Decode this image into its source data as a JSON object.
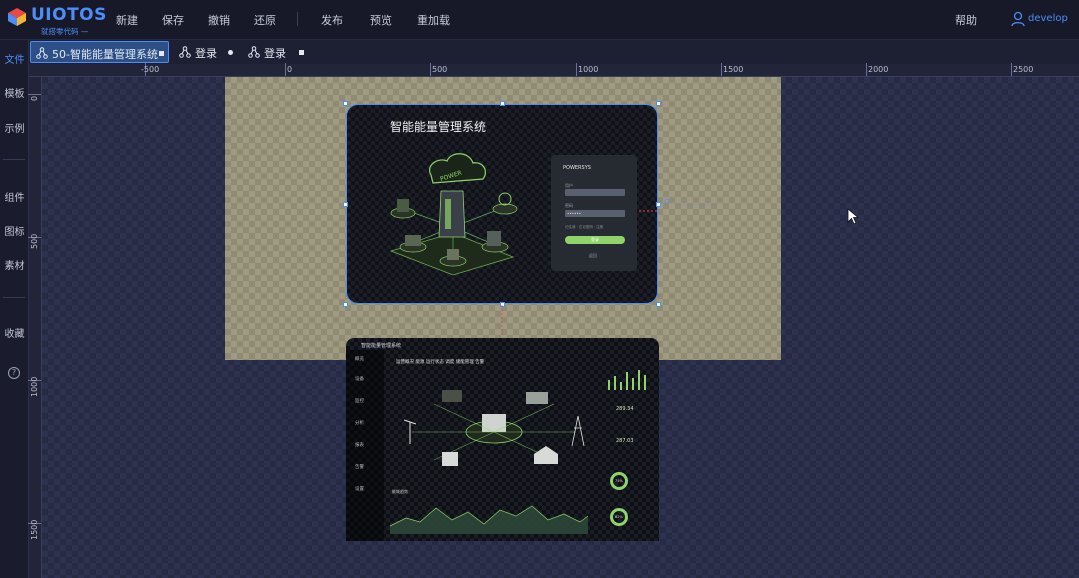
{
  "app": {
    "logo_text": "UIOTOS",
    "logo_sub": "就搭零代码 —"
  },
  "menu": {
    "items": [
      "新建",
      "保存",
      "撤销",
      "还原",
      "发布",
      "预览",
      "重加载"
    ],
    "help": "帮助",
    "user": "develop"
  },
  "sidebar": {
    "items": [
      "文件",
      "模板",
      "示例",
      "组件",
      "图标",
      "素材",
      "收藏"
    ],
    "active": "文件",
    "help_glyph": "?"
  },
  "tabs": [
    {
      "label": "50-智能能量管理系统",
      "active": true
    },
    {
      "label": "登录",
      "active": false
    },
    {
      "label": "登录",
      "active": false
    }
  ],
  "ruler": {
    "top_labels": [
      "-500",
      "0",
      "500",
      "1000",
      "1500",
      "2000",
      "2500"
    ],
    "left_labels": [
      "0",
      "500",
      "1000",
      "1500"
    ]
  },
  "login_preview": {
    "title": "智能能量管理系统",
    "brand": "POWERSYS",
    "user_label": "用户",
    "pass_label": "密码",
    "pass_value": "••••••",
    "hint": "记住我 · 忘记密码 · 注册",
    "login_button": "登录",
    "back": "返回"
  },
  "dashboard_preview": {
    "title": "智能能量管理系统",
    "side_items": [
      "概览",
      "设备",
      "监控",
      "分析",
      "报表",
      "告警",
      "设置"
    ],
    "tabs": "运营概况  能源  运行状态  调度  储能管理  告警",
    "stats": [
      "289.34",
      "287.03"
    ],
    "rings": [
      "75%",
      "82%"
    ],
    "chart_title": "能耗趋势"
  },
  "colors": {
    "accent": "#4b8ef7",
    "green": "#8fd36a",
    "artboard": "#8f8a74"
  }
}
